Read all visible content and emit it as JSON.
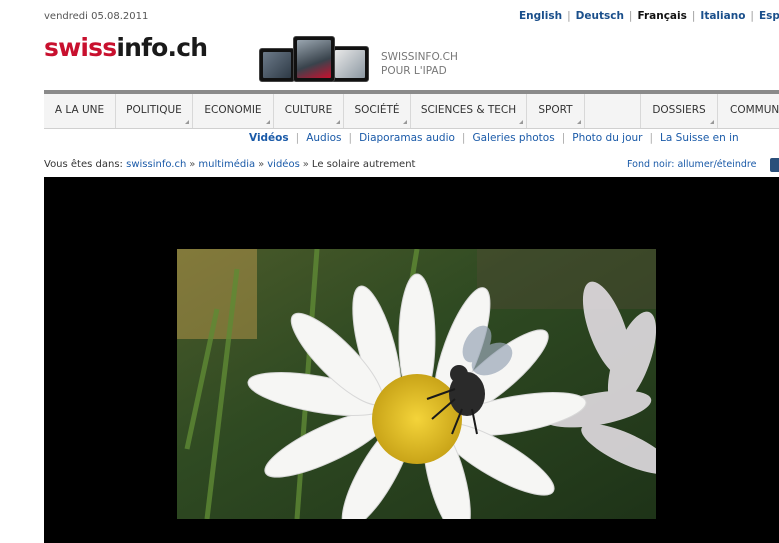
{
  "header": {
    "date": "vendredi 05.08.2011",
    "languages": [
      "English",
      "Deutsch",
      "Français",
      "Italiano",
      "Espan"
    ],
    "active_language": "Français"
  },
  "logo": {
    "part1": "swiss",
    "part2": "info.ch"
  },
  "promo": {
    "line1": "SWISSINFO.CH",
    "line2": "POUR L'IPAD"
  },
  "nav": {
    "items": [
      "A LA UNE",
      "POLITIQUE",
      "ECONOMIE",
      "CULTURE",
      "SOCIÉTÉ",
      "SCIENCES & TECH",
      "SPORT",
      "",
      "DOSSIERS",
      "COMMUNA"
    ]
  },
  "subnav": {
    "items": [
      "Vidéos",
      "Audios",
      "Diaporamas audio",
      "Galeries photos",
      "Photo du jour",
      "La Suisse en in"
    ],
    "active": "Vidéos"
  },
  "breadcrumb": {
    "prefix": "Vous êtes dans:",
    "links": [
      "swissinfo.ch",
      "multimédia",
      "vidéos"
    ],
    "current": "Le solaire autrement"
  },
  "fond_noir": "Fond noir: allumer/éteindre",
  "colors": {
    "brand_red": "#c8102e",
    "link_blue": "#1a5aa8",
    "nav_bg": "#f4f4f4",
    "player_bg": "#000000"
  }
}
